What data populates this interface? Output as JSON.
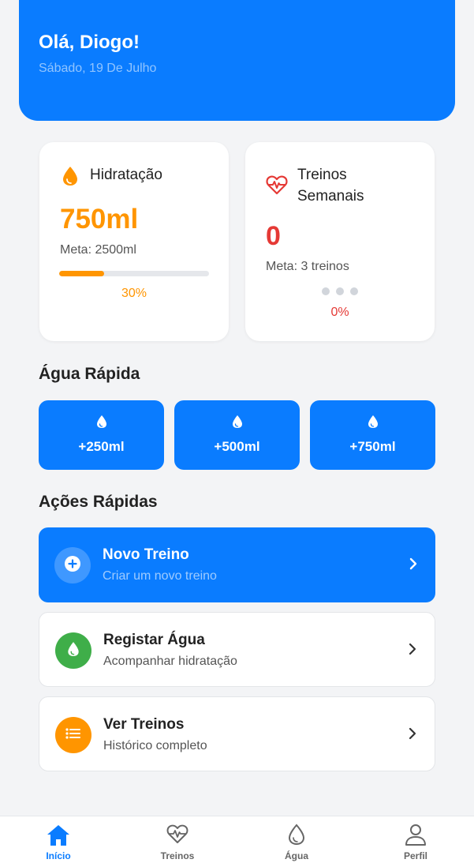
{
  "header": {
    "greeting": "Olá, Diogo!",
    "date": "Sábado, 19 De Julho"
  },
  "hydration": {
    "title": "Hidratação",
    "value": "750ml",
    "goal": "Meta: 2500ml",
    "progress_fraction": 0.3,
    "percent_label": "30%",
    "icon": "water-drop-icon",
    "color": "#ff9500"
  },
  "workouts": {
    "title_line1": "Treinos",
    "title_line2": "Semanais",
    "value": "0",
    "goal": "Meta: 3 treinos",
    "completed": 0,
    "target": 3,
    "percent_label": "0%",
    "icon": "heartbeat-icon",
    "color": "#e53935"
  },
  "quick_water": {
    "title": "Água Rápida",
    "buttons": [
      {
        "label": "+250ml",
        "icon": "water-drop-icon"
      },
      {
        "label": "+500ml",
        "icon": "water-drop-icon"
      },
      {
        "label": "+750ml",
        "icon": "water-drop-icon"
      }
    ]
  },
  "quick_actions": {
    "title": "Ações Rápidas",
    "items": [
      {
        "title": "Novo Treino",
        "subtitle": "Criar um novo treino",
        "icon": "plus-circle-icon",
        "style": "primary"
      },
      {
        "title": "Registar Água",
        "subtitle": "Acompanhar hidratação",
        "icon": "water-drop-icon",
        "color": "#3fae49"
      },
      {
        "title": "Ver Treinos",
        "subtitle": "Histórico completo",
        "icon": "list-icon",
        "color": "#ff9500"
      }
    ]
  },
  "nav": {
    "items": [
      {
        "label": "Início",
        "icon": "home-icon",
        "active": true
      },
      {
        "label": "Treinos",
        "icon": "heartbeat-icon",
        "active": false
      },
      {
        "label": "Água",
        "icon": "water-drop-icon",
        "active": false
      },
      {
        "label": "Perfil",
        "icon": "user-icon",
        "active": false
      }
    ]
  },
  "colors": {
    "primary": "#0a7cff",
    "orange": "#ff9500",
    "red": "#e53935",
    "green": "#3fae49"
  }
}
